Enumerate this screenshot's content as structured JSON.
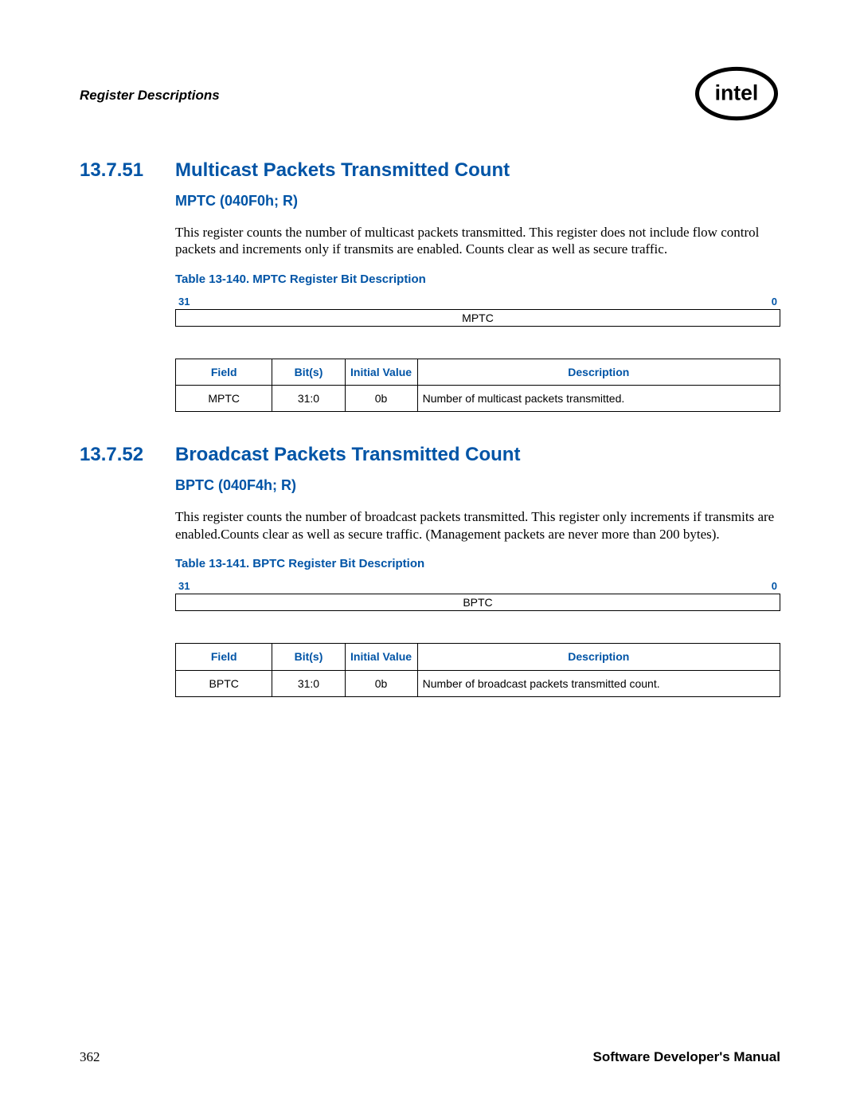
{
  "header": {
    "chapter_title": "Register Descriptions"
  },
  "sections": [
    {
      "number": "13.7.51",
      "title": "Multicast Packets Transmitted Count",
      "subheading": "MPTC (040F0h; R)",
      "body": "This register counts the number of multicast packets transmitted. This register does not include flow control packets and increments only if transmits are enabled. Counts clear as well as secure traffic.",
      "table_caption": "Table 13-140. MPTC Register Bit Description",
      "bit_high": "31",
      "bit_low": "0",
      "bit_field_name": "MPTC",
      "table": {
        "headers": {
          "field": "Field",
          "bits": "Bit(s)",
          "initial": "Initial Value",
          "desc": "Description"
        },
        "row": {
          "field": "MPTC",
          "bits": "31:0",
          "initial": "0b",
          "desc": "Number of multicast packets transmitted."
        }
      }
    },
    {
      "number": "13.7.52",
      "title": "Broadcast Packets Transmitted Count",
      "subheading": "BPTC (040F4h; R)",
      "body": "This register counts the number of broadcast packets transmitted. This register only increments if transmits are enabled.Counts clear as well as secure traffic. (Management packets are never more than 200 bytes).",
      "table_caption": "Table 13-141. BPTC Register Bit Description",
      "bit_high": "31",
      "bit_low": "0",
      "bit_field_name": "BPTC",
      "table": {
        "headers": {
          "field": "Field",
          "bits": "Bit(s)",
          "initial": "Initial Value",
          "desc": "Description"
        },
        "row": {
          "field": "BPTC",
          "bits": "31:0",
          "initial": "0b",
          "desc": "Number of broadcast packets transmitted count."
        }
      }
    }
  ],
  "footer": {
    "page_number": "362",
    "manual_title": "Software Developer's Manual"
  }
}
